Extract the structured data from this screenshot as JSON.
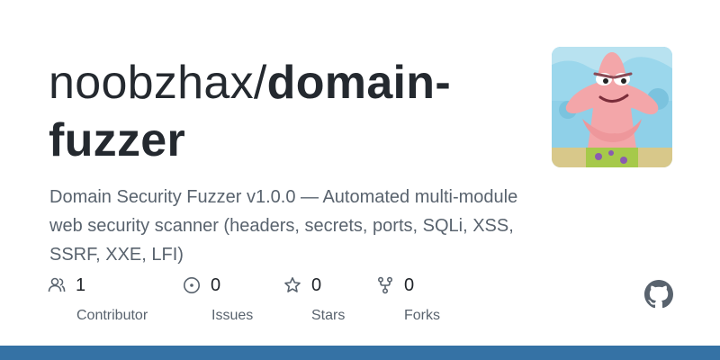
{
  "repo": {
    "owner": "noobzhax/",
    "name": "domain-fuzzer",
    "description": "Domain Security Fuzzer v1.0.0 — Automated multi-module web security scanner (headers, secrets, ports, SQLi, XSS, SSRF, XXE, LFI)"
  },
  "stats": [
    {
      "icon": "people-icon",
      "value": "1",
      "label": "Contributor"
    },
    {
      "icon": "issue-icon",
      "value": "0",
      "label": "Issues"
    },
    {
      "icon": "star-icon",
      "value": "0",
      "label": "Stars"
    },
    {
      "icon": "fork-icon",
      "value": "0",
      "label": "Forks"
    }
  ],
  "colors": {
    "language_bar": "#3572a5",
    "title": "#24292f",
    "muted": "#59636e"
  }
}
